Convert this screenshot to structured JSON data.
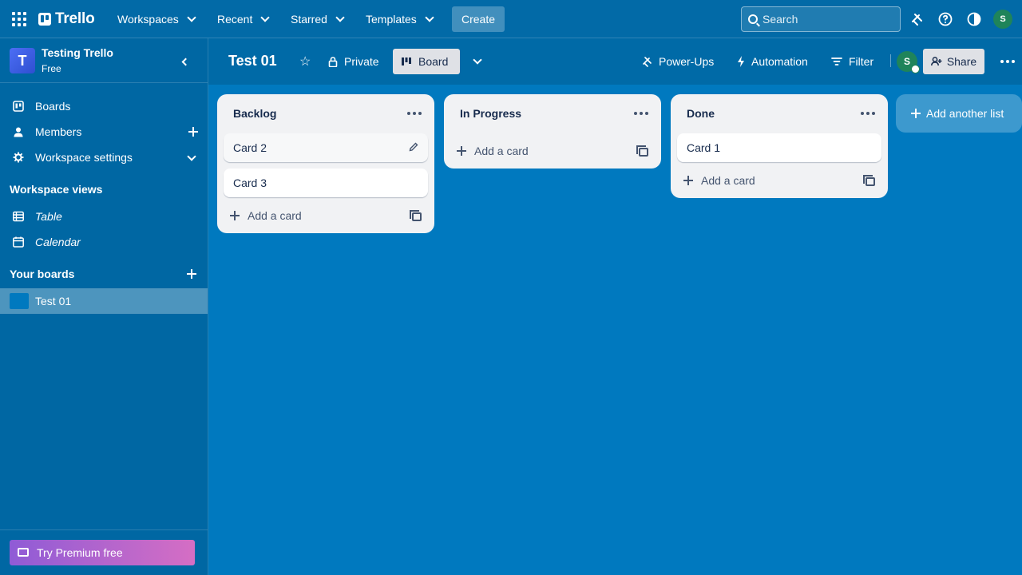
{
  "topnav": {
    "logo": "Trello",
    "menus": [
      "Workspaces",
      "Recent",
      "Starred",
      "Templates"
    ],
    "create_label": "Create",
    "search_placeholder": "Search",
    "avatar_initial": "S"
  },
  "sidebar": {
    "workspace_name": "Testing Trello",
    "workspace_initial": "T",
    "workspace_plan": "Free",
    "items": [
      {
        "label": "Boards",
        "icon": "board-icon"
      },
      {
        "label": "Members",
        "icon": "person-icon"
      },
      {
        "label": "Workspace settings",
        "icon": "gear-icon"
      }
    ],
    "views_heading": "Workspace views",
    "views": [
      {
        "label": "Table",
        "icon": "table-icon"
      },
      {
        "label": "Calendar",
        "icon": "calendar-icon"
      }
    ],
    "boards_heading": "Your boards",
    "boards": [
      {
        "label": "Test 01",
        "color": "#0079bf"
      }
    ],
    "premium_label": "Try Premium free"
  },
  "board": {
    "title": "Test 01",
    "visibility": "Private",
    "view": "Board",
    "powerups": "Power-Ups",
    "automation": "Automation",
    "filter": "Filter",
    "member_initial": "S",
    "share": "Share"
  },
  "lists": [
    {
      "title": "Backlog",
      "cards": [
        "Card 2",
        "Card 3"
      ],
      "add_label": "Add a card"
    },
    {
      "title": "In Progress",
      "cards": [],
      "add_label": "Add a card"
    },
    {
      "title": "Done",
      "cards": [
        "Card 1"
      ],
      "add_label": "Add a card"
    }
  ],
  "add_list_label": "Add another list",
  "colors": {
    "background": "#0079bf",
    "header": "#026aa7",
    "sidebar": "#0067a3",
    "avatar": "#1f845a"
  }
}
